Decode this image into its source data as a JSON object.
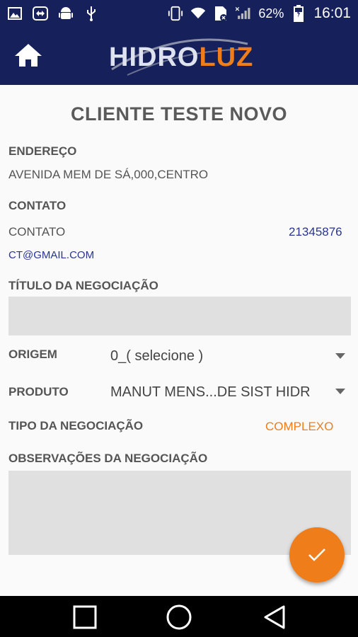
{
  "status_bar": {
    "battery_percent": "62%",
    "time": "16:01"
  },
  "app_bar": {
    "logo_part1": "HIDRO",
    "logo_part2": "LUZ"
  },
  "client": {
    "name": "CLIENTE TESTE NOVO",
    "address_label": "ENDEREÇO",
    "address": "AVENIDA MEM DE SÁ,000,CENTRO",
    "contact_label": "CONTATO",
    "contact_name": "CONTATO",
    "contact_phone": "21345876",
    "contact_email": "CT@GMAIL.COM"
  },
  "form": {
    "title_label": "TÍTULO DA NEGOCIAÇÃO",
    "title_value": "",
    "origin_label": "ORIGEM",
    "origin_value": "0_( selecione )",
    "product_label": "PRODUTO",
    "product_value": "MANUT MENS...DE SIST HIDR",
    "type_label": "TIPO DA NEGOCIAÇÃO",
    "type_value": "COMPLEXO",
    "notes_label": "OBSERVAÇÕES DA NEGOCIAÇÃO",
    "notes_value": ""
  },
  "colors": {
    "primary": "#16205a",
    "accent": "#ef7d1a",
    "link": "#283593"
  }
}
